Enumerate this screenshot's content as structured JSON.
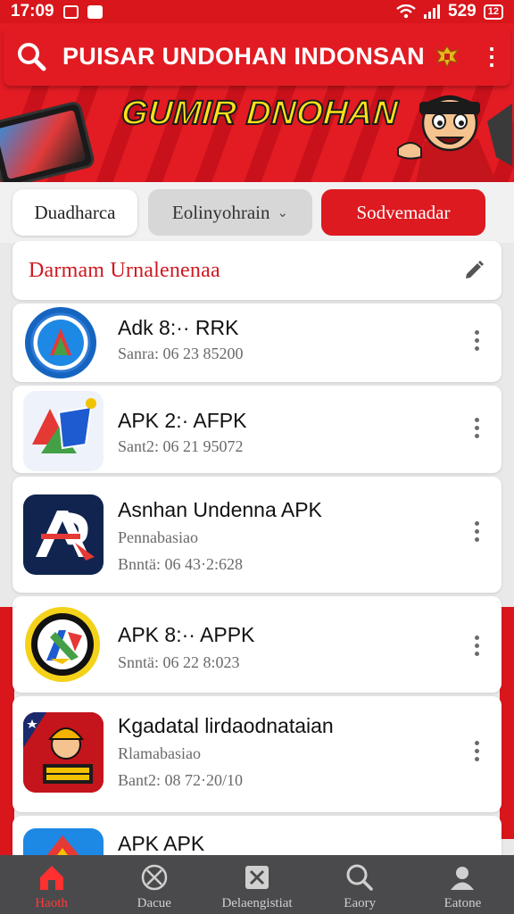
{
  "status_bar": {
    "time": "17:09",
    "carrier_signal": "529",
    "battery": "12"
  },
  "header": {
    "title": "PUISAR UNDOHAN INDONSAN"
  },
  "banner": {
    "text": "GUMIR DNOHAN"
  },
  "tabs": [
    {
      "label": "Duadharca"
    },
    {
      "label": "Eolinyohrain"
    },
    {
      "label": "Sodvemadar"
    }
  ],
  "section": {
    "title": "Darmam Urnalenenaa"
  },
  "apps": [
    {
      "name": "Adk 8:·· RRK",
      "sub1": "Sanra: 06 23 85200",
      "sub2": ""
    },
    {
      "name": "APK 2:· AFPK",
      "sub1": "Sant2: 06 21 95072",
      "sub2": ""
    },
    {
      "name": "Asnhan Undenna APK",
      "sub1": "Pennabasiao",
      "sub2": "Bnntä: 06 43·2:628"
    },
    {
      "name": "APK 8:·· APPK",
      "sub1": "Snntä: 06 22 8:023",
      "sub2": ""
    },
    {
      "name": "Kgadatal lirdaodnataian",
      "sub1": "Rlamabasiao",
      "sub2": "Bant2: 08 72·20/10"
    },
    {
      "name": "APK APK",
      "sub1": "",
      "sub2": ""
    }
  ],
  "bottom_nav": [
    {
      "label": "Haoth",
      "icon": "home-icon",
      "active": true
    },
    {
      "label": "Dacue",
      "icon": "compass-icon",
      "active": false
    },
    {
      "label": "Delaengistiat",
      "icon": "apps-icon",
      "active": false
    },
    {
      "label": "Eaory",
      "icon": "search-icon",
      "active": false
    },
    {
      "label": "Eatone",
      "icon": "profile-icon",
      "active": false
    }
  ],
  "colors": {
    "brand_red": "#e21b22",
    "nav_bg": "#4a4a4c",
    "active_nav": "#ff3b3b"
  }
}
